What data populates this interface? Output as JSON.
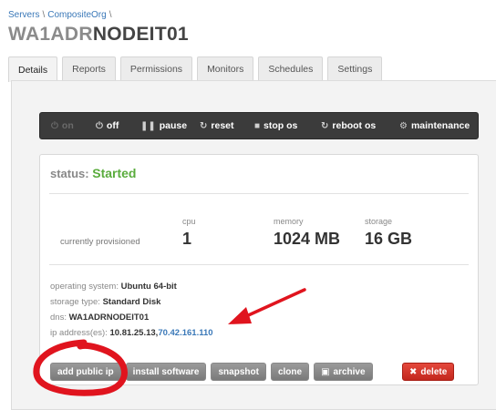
{
  "breadcrumb": {
    "items": [
      "Servers",
      "CompositeOrg"
    ],
    "separator": "\\"
  },
  "server": {
    "name_prefix": "WA1ADR",
    "name_suffix": "NODEIT01"
  },
  "tabs": [
    "Details",
    "Reports",
    "Permissions",
    "Monitors",
    "Schedules",
    "Settings"
  ],
  "toolbar": {
    "on": "on",
    "off": "off",
    "pause": "pause",
    "reset": "reset",
    "stop_os": "stop os",
    "reboot_os": "reboot os",
    "maintenance": "maintenance"
  },
  "status": {
    "label": "status:",
    "value": "Started"
  },
  "provisioned_label": "currently provisioned",
  "resources": {
    "cpu": {
      "label": "cpu",
      "value": "1"
    },
    "memory": {
      "label": "memory",
      "value": "1024 MB"
    },
    "storage": {
      "label": "storage",
      "value": "16 GB"
    }
  },
  "details": {
    "os_label": "operating system:",
    "os_value": "Ubuntu 64-bit",
    "storage_type_label": "storage type:",
    "storage_type_value": "Standard Disk",
    "dns_label": "dns:",
    "dns_value": "WA1ADRNODEIT01",
    "ip_label": "ip address(es):",
    "ip_private": "10.81.25.13",
    "ip_separator": ",",
    "ip_public": "70.42.161.110"
  },
  "actions": {
    "add_public_ip": "add public ip",
    "install_software": "install software",
    "snapshot": "snapshot",
    "clone": "clone",
    "archive": "archive",
    "delete": "delete"
  },
  "colors": {
    "status_green": "#5aac3d",
    "link_blue": "#3a78b8",
    "annotation_red": "#e0141e",
    "delete_red": "#d0352a"
  },
  "icons": [
    "power-icon",
    "pause-icon",
    "refresh-icon",
    "stop-icon",
    "gears-icon",
    "archive-icon",
    "close-icon"
  ]
}
